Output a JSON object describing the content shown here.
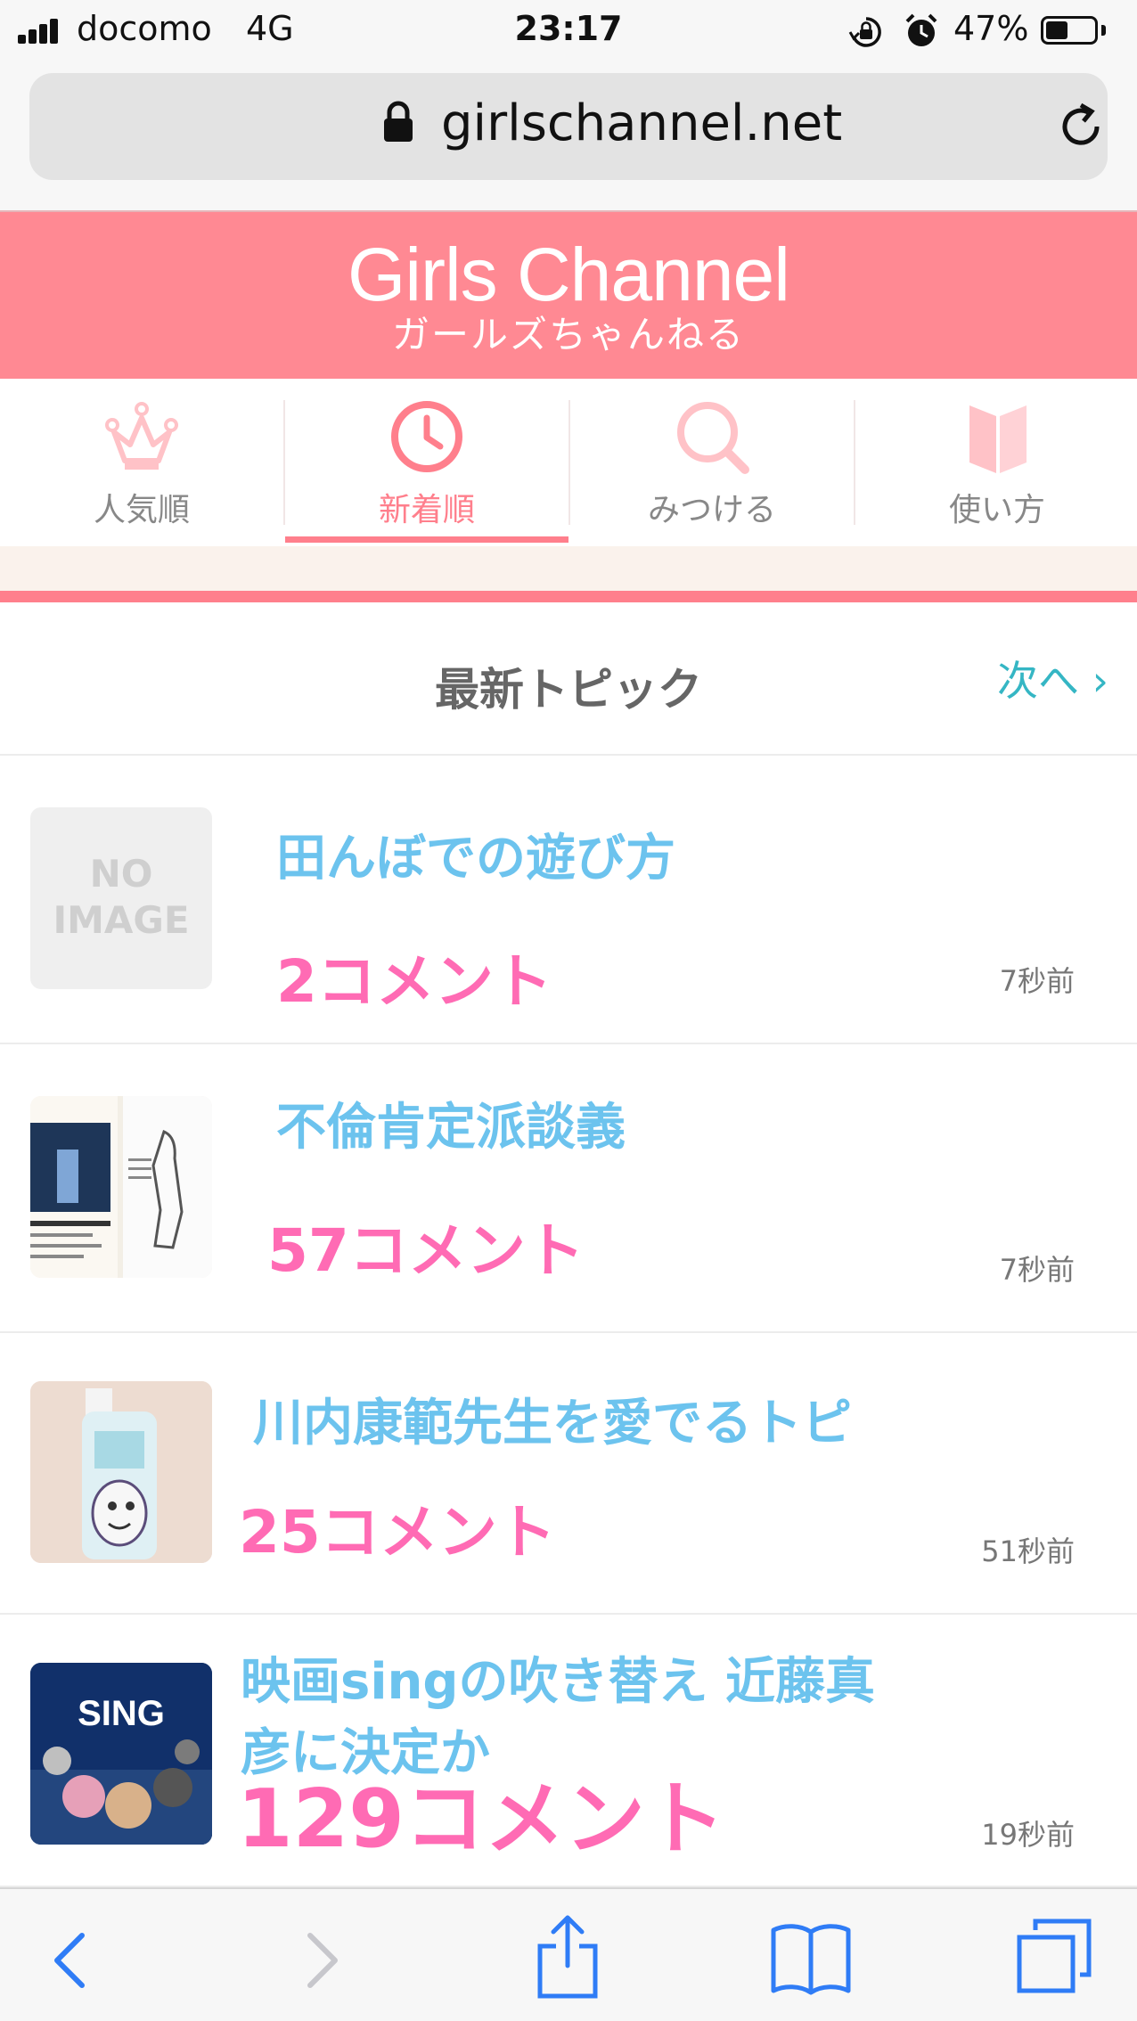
{
  "status_bar": {
    "carrier": "docomo",
    "network": "4G",
    "time": "23:17",
    "battery_percent": "47%",
    "battery_level": 0.47
  },
  "browser": {
    "url": "girlschannel.net"
  },
  "site": {
    "logo_en": "Girls Channel",
    "logo_ja": "ガールズちゃんねる",
    "accent_color": "#ff8993"
  },
  "nav": {
    "tabs": [
      {
        "label": "人気順",
        "icon": "crown-icon",
        "active": false
      },
      {
        "label": "新着順",
        "icon": "clock-icon",
        "active": true
      },
      {
        "label": "みつける",
        "icon": "search-icon",
        "active": false
      },
      {
        "label": "使い方",
        "icon": "book-icon",
        "active": false
      }
    ]
  },
  "section": {
    "title": "最新トピック",
    "next_label": "次へ ›"
  },
  "topics": [
    {
      "title": "田んぼでの遊び方",
      "comments": "2コメント",
      "time": "7秒前",
      "thumb": "no-image",
      "thumb_text_1": "NO",
      "thumb_text_2": "IMAGE"
    },
    {
      "title": "不倫肯定派談義",
      "comments": "57コメント",
      "time": "7秒前",
      "thumb": "book-covers"
    },
    {
      "title": "川内康範先生を愛でるトピ",
      "comments": "25コメント",
      "time": "51秒前",
      "thumb": "bottle"
    },
    {
      "title": "映画singの吹き替え 近藤真彦に決定か",
      "comments": "129コメント",
      "time": "19秒前",
      "thumb": "sing-poster",
      "thumb_text_1": "SING"
    }
  ],
  "toolbar": {
    "icons": [
      "back-icon",
      "forward-icon",
      "share-icon",
      "bookmarks-icon",
      "tabs-icon"
    ]
  }
}
